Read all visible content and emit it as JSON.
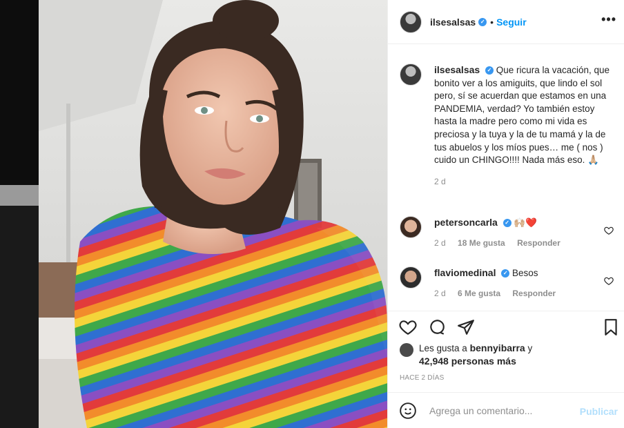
{
  "post": {
    "username": "ilsesalsas",
    "follow_label": "Seguir",
    "more_label": "•••"
  },
  "caption": {
    "username": "ilsesalsas",
    "text": "Que ricura la vacación, que bonito ver a los amiguits, que lindo el sol pero, sí se acuerdan que estamos en una PANDEMIA, verdad? Yo también estoy hasta la madre pero como mi vida es preciosa y la tuya y la de tu mamá y la de tus abuelos y los míos pues… me ( nos ) cuido un CHINGO!!!! Nada más eso. 🙏🏼",
    "time": "2 d"
  },
  "comments": [
    {
      "username": "petersoncarla",
      "text": "🙌🏼❤️",
      "time": "2 d",
      "likes": "18 Me gusta",
      "reply": "Responder"
    },
    {
      "username": "flaviomedinal",
      "text": "Besos",
      "time": "2 d",
      "likes": "6 Me gusta",
      "reply": "Responder"
    }
  ],
  "likes": {
    "prefix": "Les gusta a",
    "user": "bennyibarra",
    "and": "y",
    "others": "42,948 personas más"
  },
  "timestamp": "HACE 2 DÍAS",
  "add_comment": {
    "placeholder": "Agrega un comentario...",
    "publish_label": "Publicar"
  },
  "colors": {
    "accent": "#0095f6",
    "verified": "#3897f0",
    "muted": "#8e8e8e",
    "publish_disabled": "#b2dffc"
  },
  "icons": {
    "verified": "verified-badge-icon",
    "like": "heart-icon",
    "comment": "comment-bubble-icon",
    "share": "paper-plane-icon",
    "save": "bookmark-icon",
    "emoji": "smiley-icon",
    "more": "ellipsis-icon"
  }
}
